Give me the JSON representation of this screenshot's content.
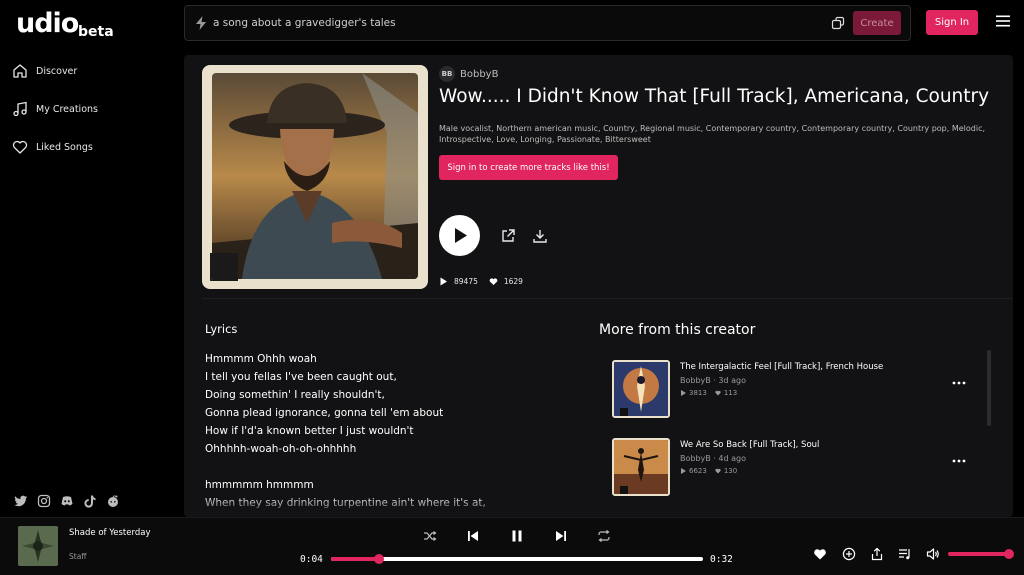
{
  "brand": {
    "name": "udio",
    "tag": "beta"
  },
  "search": {
    "placeholder": "a song about a gravedigger's tales",
    "create_label": "Create"
  },
  "header": {
    "signin_label": "Sign In"
  },
  "sidebar": {
    "items": [
      {
        "label": "Discover",
        "icon": "home-icon"
      },
      {
        "label": "My Creations",
        "icon": "music-note-icon"
      },
      {
        "label": "Liked Songs",
        "icon": "heart-icon"
      }
    ],
    "socials": [
      "twitter-icon",
      "instagram-icon",
      "discord-icon",
      "tiktok-icon",
      "reddit-icon"
    ]
  },
  "song": {
    "artist_initials": "BB",
    "artist": "BobbyB",
    "title": "Wow..... I Didn't Know That [Full Track], Americana, Country",
    "tags": "Male vocalist, Northern american music, Country, Regional music, Contemporary country, Contemporary country, Country pop, Melodic, Introspective, Love, Longing, Passionate, Bittersweet",
    "cta_label": "Sign in to create more tracks like this!",
    "plays": "89475",
    "likes": "1629"
  },
  "lyrics": {
    "heading": "Lyrics",
    "text": "Hmmmm Ohhh woah\nI tell you fellas I've been caught out,\nDoing somethin' I really shouldn't,\nGonna plead ignorance, gonna tell 'em about\nHow if I'd'a known better I just wouldn't\nOhhhhh-woah-oh-oh-ohhhhh\n\nhmmmmm hmmmm\nWhen they say drinking turpentine ain't where it's at,"
  },
  "more": {
    "heading": "More from this creator",
    "items": [
      {
        "title": "The Intergalactic Feel [Full Track], French House",
        "artist": "BobbyB",
        "age": "3d ago",
        "plays": "3813",
        "likes": "113"
      },
      {
        "title": "We Are So Back [Full Track], Soul",
        "artist": "BobbyB",
        "age": "4d ago",
        "plays": "6623",
        "likes": "130"
      }
    ]
  },
  "player": {
    "title": "Shade of Yesterday",
    "artist": "Staff",
    "elapsed": "0:04",
    "duration": "0:32",
    "progress": 0.13,
    "volume": 0.98
  },
  "colors": {
    "accent": "#e0255f",
    "panel": "#121214",
    "background": "#000000"
  }
}
